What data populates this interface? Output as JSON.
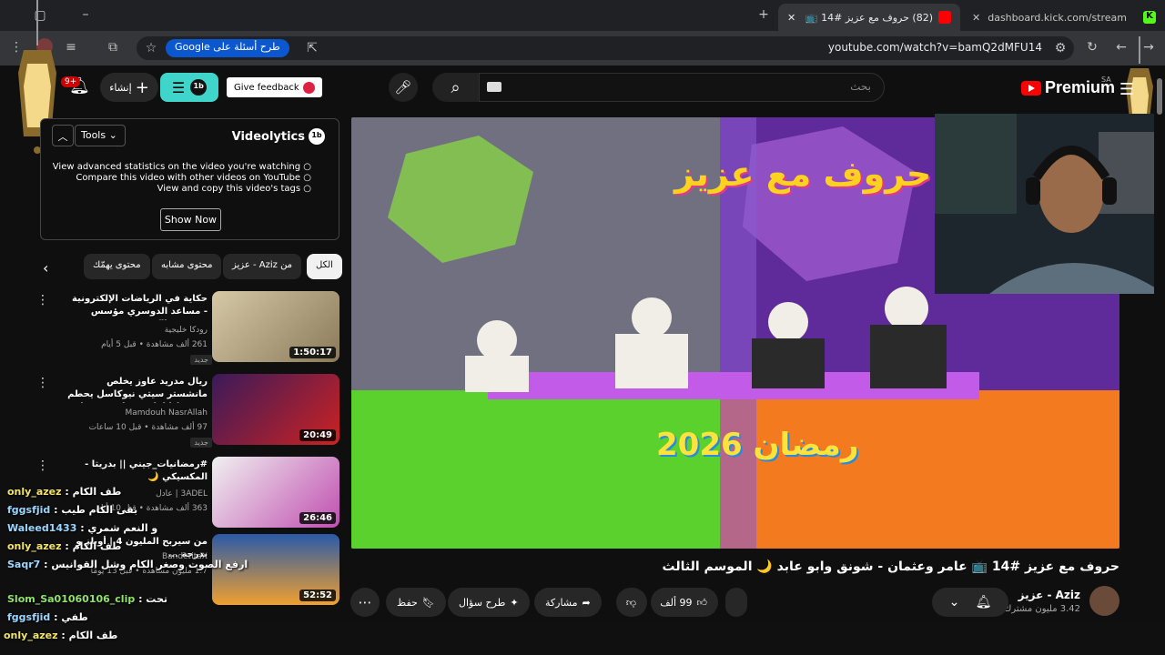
{
  "browser": {
    "tabs": [
      {
        "label": "(82) حروف مع عزيز #14 📺 عامر",
        "active": true
      },
      {
        "label": "dashboard.kick.com/stream",
        "active": false
      }
    ],
    "new_tab": "+",
    "url": "youtube.com/watch?v=bamQ2dMFU14",
    "google_chip": "طرح أسئلة على Google"
  },
  "header": {
    "logo": "Premium",
    "region": "SA",
    "search_placeholder": "بحث",
    "feedback": "Give feedback",
    "create": "إنشاء",
    "notifications_badge": "9+"
  },
  "videolytics": {
    "title": "Videolytics",
    "tools": "Tools",
    "items": [
      "View advanced statistics on the video you're watching",
      "Compare this video with other videos on YouTube",
      "View and copy this video's tags"
    ],
    "show_now": "Show Now"
  },
  "chips": [
    "الكل",
    "من Aziz - عزيز",
    "محتوى مشابه",
    "محتوى يهمّك"
  ],
  "recommendations": [
    {
      "title": "حكاية في الرياضات الإلكترونية - مساعد الدوسري مؤسس ورئيس فالكونز ضيف ...",
      "channel": "رودكا خليجية",
      "meta": "261 ألف مشاهدة • قبل 5 أيام",
      "badge": "جديد",
      "duration": "1:50:17"
    },
    {
      "title": "ريال مدريد عاوز يخلص مانشستر سيتي نيوكاسل يحطم ريمونتادا امام برشلونة توقعات عودة ...",
      "channel": "Mamdouh NasrAllah",
      "meta": "97 ألف مشاهدة • قبل 10 ساعات",
      "badge": "جديد",
      "duration": "20:49"
    },
    {
      "title": "#رمضانيات_جيني || بدريتا - المكسيكي 🌙",
      "channel": "3ADEL | عادل",
      "meta": "363 ألف مشاهدة • قبل 10 أيام",
      "badge": "",
      "duration": "26:46"
    },
    {
      "title": "من سيربح المليون 4 | أوبلز و بدرجة ...",
      "channel": "BanderitaX",
      "meta": "1.7 مليون مشاهدة • قبل 13 يومًا",
      "badge": "",
      "duration": "52:52"
    }
  ],
  "video": {
    "title": "حروف مع عزيز #14 📺 عامر وعثمان - شونق وابو عابد 🌙 الموسم الثالث",
    "channel": "Aziz - عزيز",
    "subscribers": "3.42 مليون مشترك",
    "likes": "99 ألف",
    "share": "مشاركة",
    "ask": "طرح سؤال",
    "save": "حفظ",
    "set_title": "حروف مع عزيز",
    "set_year": "رمضان 2026"
  },
  "chat": [
    {
      "user": "only_azez",
      "msg": "طف الكام"
    },
    {
      "user": "fggsfjid",
      "msg": "بقى الكام طيب"
    },
    {
      "user": "Waleed1433",
      "msg": "و النعم شمري"
    },
    {
      "user": "only_azez",
      "msg": "طف الكام"
    },
    {
      "user": "Saqr7",
      "msg": "ارفع الصوت وصغر الكام وشل القوانيس"
    },
    {
      "user": "Slom_Sa01060106_clip",
      "msg": "تحت"
    },
    {
      "user": "fggsfjid",
      "msg": "طفي"
    },
    {
      "user": "only_azez",
      "msg": "طف الكام"
    }
  ],
  "colors": {
    "accent": "#3fd5ca",
    "youtube_red": "#ff0000",
    "chat_user": "#f2e46b"
  }
}
